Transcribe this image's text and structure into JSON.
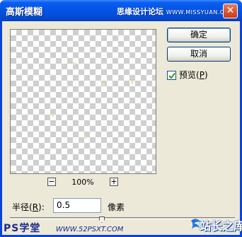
{
  "window": {
    "title": "高斯模糊",
    "watermark_cn": "思缘设计论坛",
    "watermark_site": "WWW.MISSYUAN.COM",
    "close_symbol": "✕"
  },
  "buttons": {
    "ok": "确定",
    "cancel": "取消"
  },
  "preview_toggle": {
    "label": "预览(",
    "hotkey": "P",
    "close_paren": ")",
    "checked": true
  },
  "zoom": {
    "minus": "−",
    "plus": "+",
    "level": "100%"
  },
  "radius": {
    "label": "半径(",
    "hotkey": "R",
    "label_end": "):",
    "value": "0.5",
    "unit": "像素"
  },
  "watermarks": {
    "bottom_left": "PS学堂",
    "bottom_site": "WWW.52PSXT.COM",
    "bottom_right": "站长之库"
  },
  "colors": {
    "titlebar": "#0553e2",
    "dialog_bg": "#ece9d8",
    "checker": "#cfcfcf"
  }
}
